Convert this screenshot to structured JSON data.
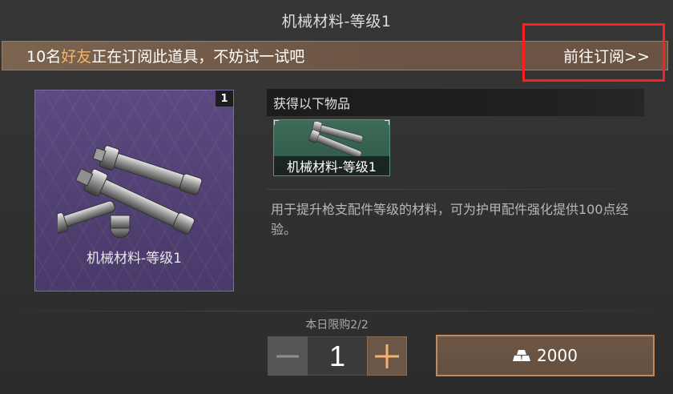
{
  "header": {
    "title": "机械材料-等级1"
  },
  "promo": {
    "count": "10",
    "text_before": "名",
    "highlight": "好友",
    "text_after": "正在订阅此道具，不妨试一试吧",
    "link_label": "前往订阅>>"
  },
  "item": {
    "name": "机械材料-等级1",
    "quantity": "1",
    "rarity_color": "#5b4a80"
  },
  "rewards": {
    "header": "获得以下物品",
    "items": [
      {
        "name": "机械材料-等级1",
        "icon": "bolts-icon"
      }
    ]
  },
  "description": "用于提升枪支配件等级的材料，可为护甲配件强化提供100点经验。",
  "purchase": {
    "daily_limit": "本日限购2/2",
    "quantity": "1",
    "minus_icon": "minus-icon",
    "plus_icon": "plus-icon",
    "price": "2000",
    "currency_icon": "gold-bar-icon",
    "accent_color": "#c08a5d"
  }
}
